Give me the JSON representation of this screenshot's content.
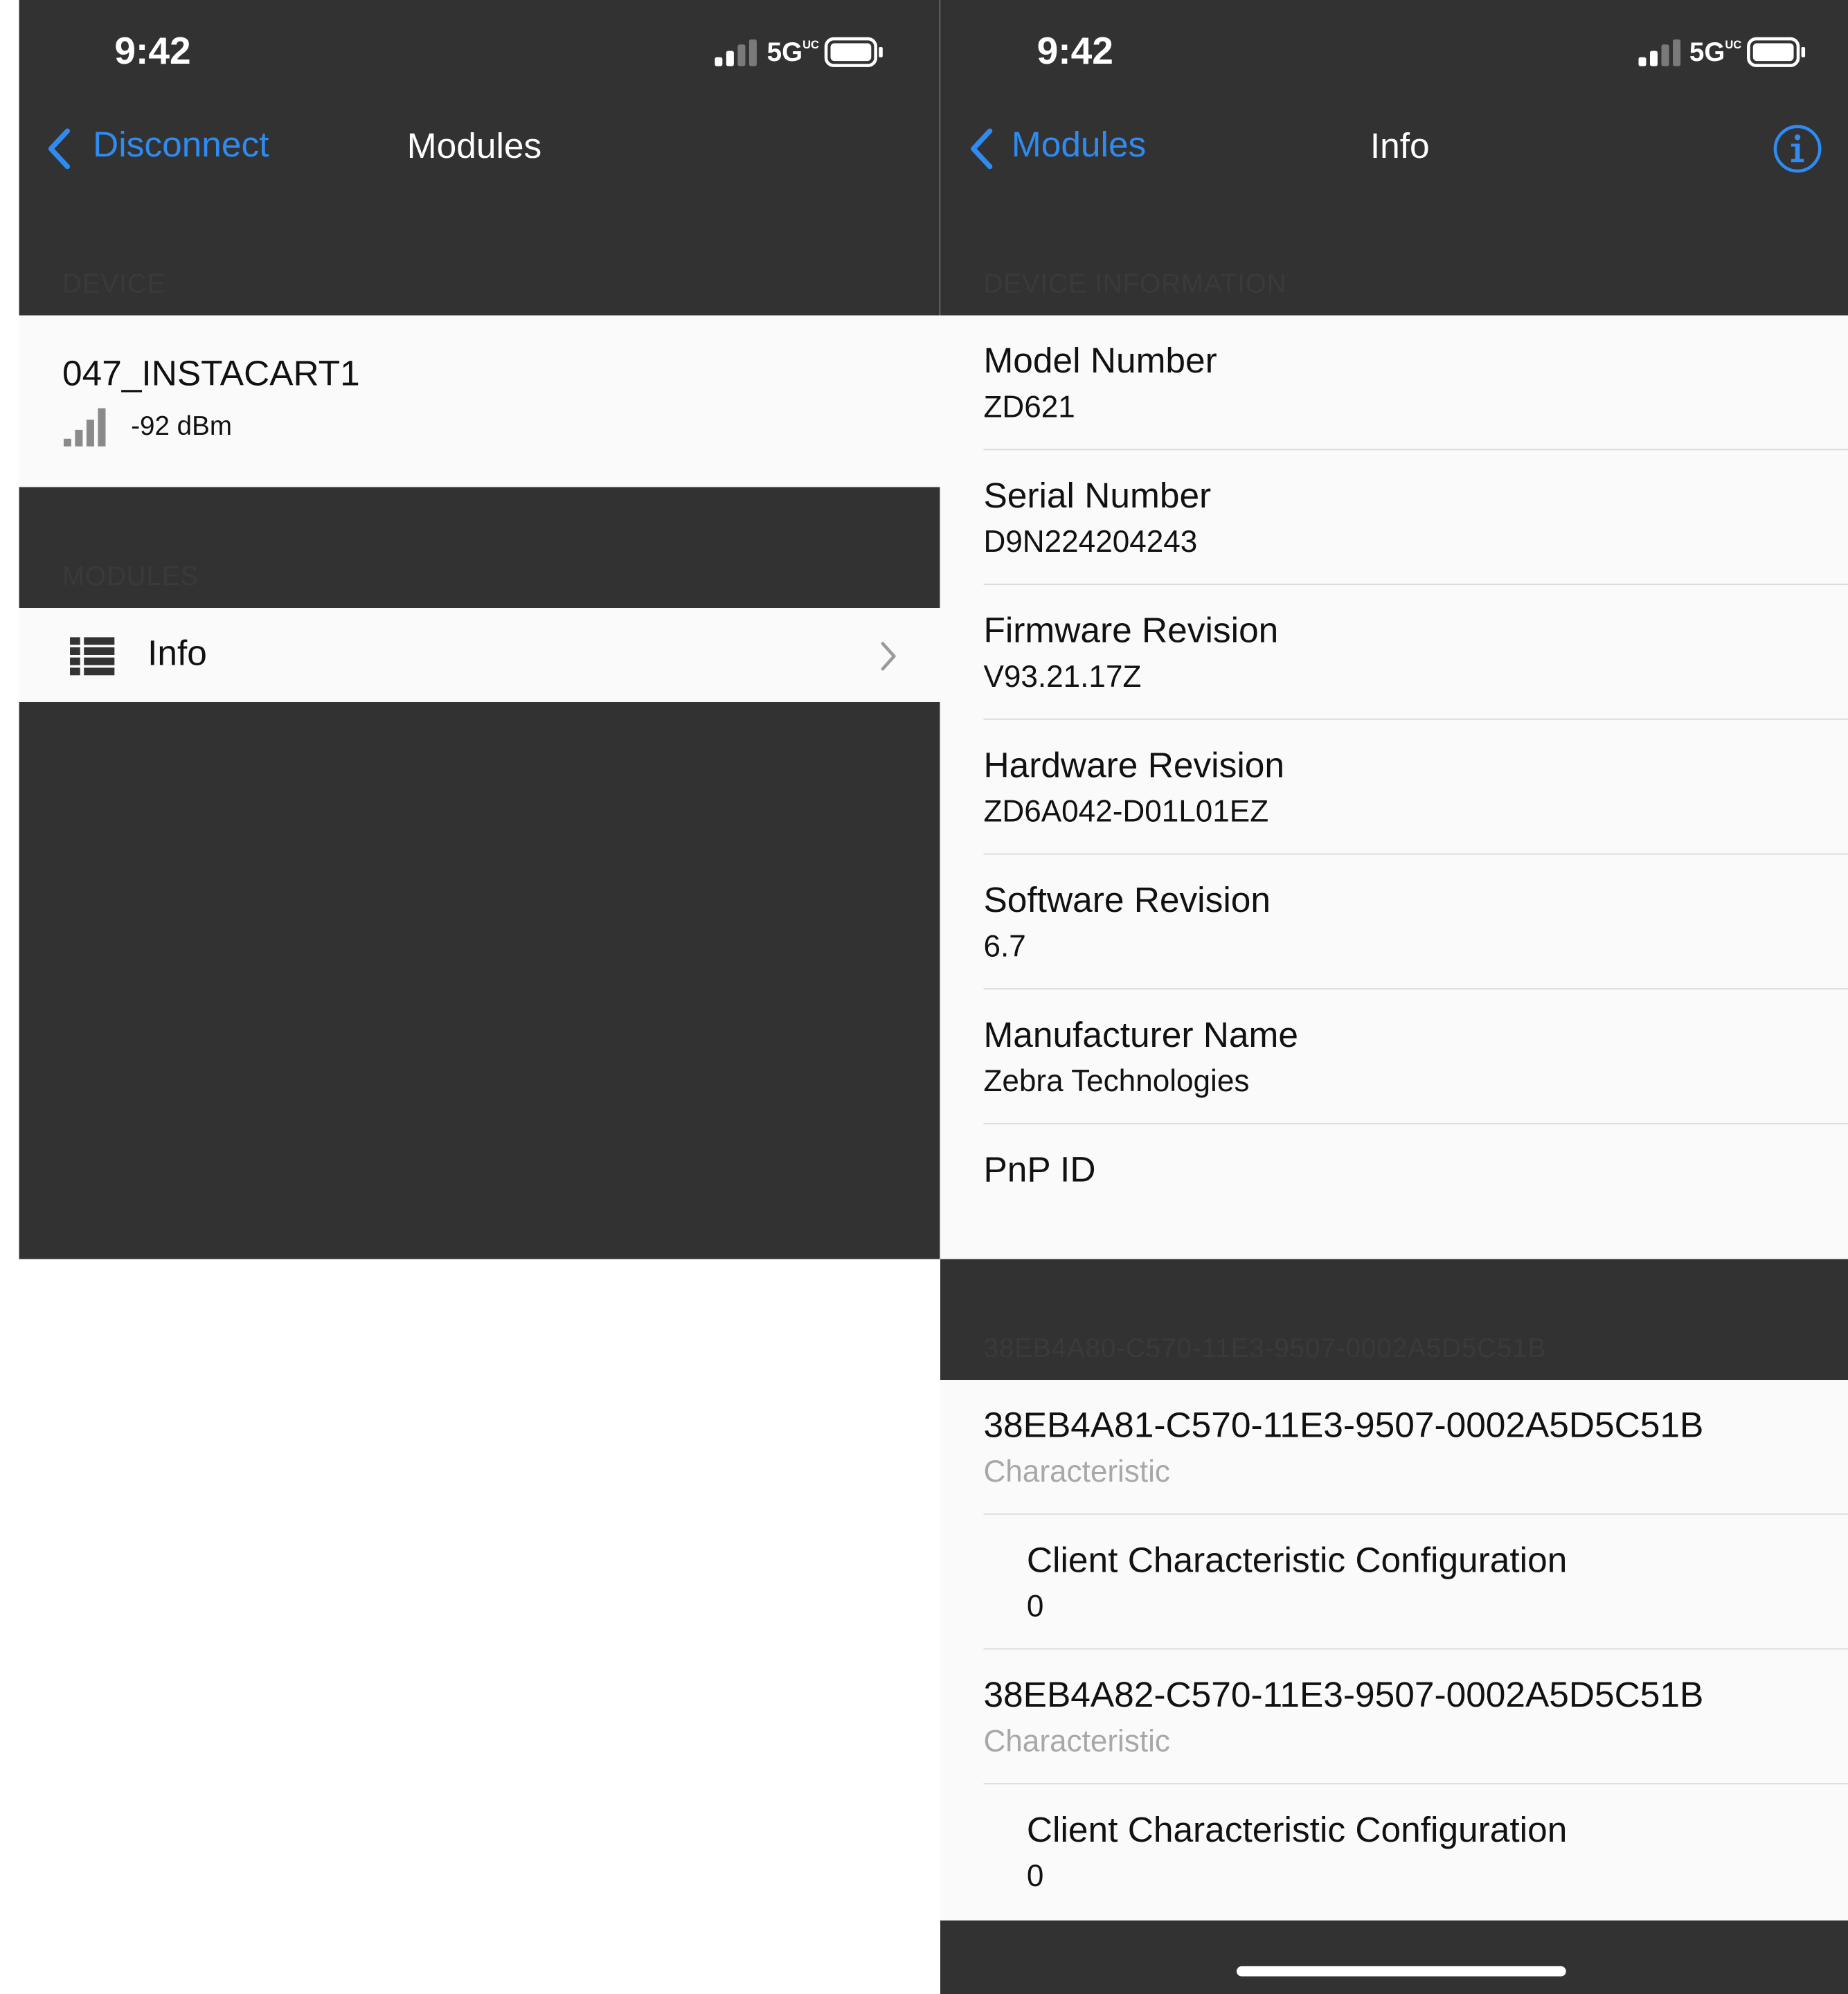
{
  "left": {
    "status": {
      "time": "9:42",
      "network": "5G",
      "network_sub": "UC"
    },
    "nav": {
      "back_label": "Disconnect",
      "title": "Modules"
    },
    "device_section": {
      "header": "DEVICE"
    },
    "device": {
      "name": "047_INSTACART1",
      "rssi": "-92 dBm"
    },
    "modules_section": {
      "header": "MODULES"
    },
    "modules": [
      {
        "label": "Info"
      }
    ]
  },
  "right": {
    "status": {
      "time": "9:42",
      "network": "5G",
      "network_sub": "UC"
    },
    "nav": {
      "back_label": "Modules",
      "title": "Info"
    },
    "device_info_section": {
      "header": "DEVICE INFORMATION"
    },
    "device_info": [
      {
        "label": "Model Number",
        "value": "ZD621"
      },
      {
        "label": "Serial Number",
        "value": "D9N224204243"
      },
      {
        "label": "Firmware Revision",
        "value": "V93.21.17Z"
      },
      {
        "label": "Hardware Revision",
        "value": "ZD6A042-D01L01EZ"
      },
      {
        "label": "Software Revision",
        "value": "6.7"
      },
      {
        "label": "Manufacturer Name",
        "value": "Zebra Technologies"
      },
      {
        "label": "PnP ID",
        "value": ""
      }
    ],
    "service_section": {
      "header": "38EB4A80-C570-11E3-9507-0002A5D5C51B"
    },
    "characteristics": [
      {
        "uuid": "38EB4A81-C570-11E3-9507-0002A5D5C51B",
        "kind": "Characteristic",
        "descriptor": {
          "label": "Client Characteristic Configuration",
          "value": "0"
        }
      },
      {
        "uuid": "38EB4A82-C570-11E3-9507-0002A5D5C51B",
        "kind": "Characteristic",
        "descriptor": {
          "label": "Client Characteristic Configuration",
          "value": "0"
        }
      }
    ]
  }
}
